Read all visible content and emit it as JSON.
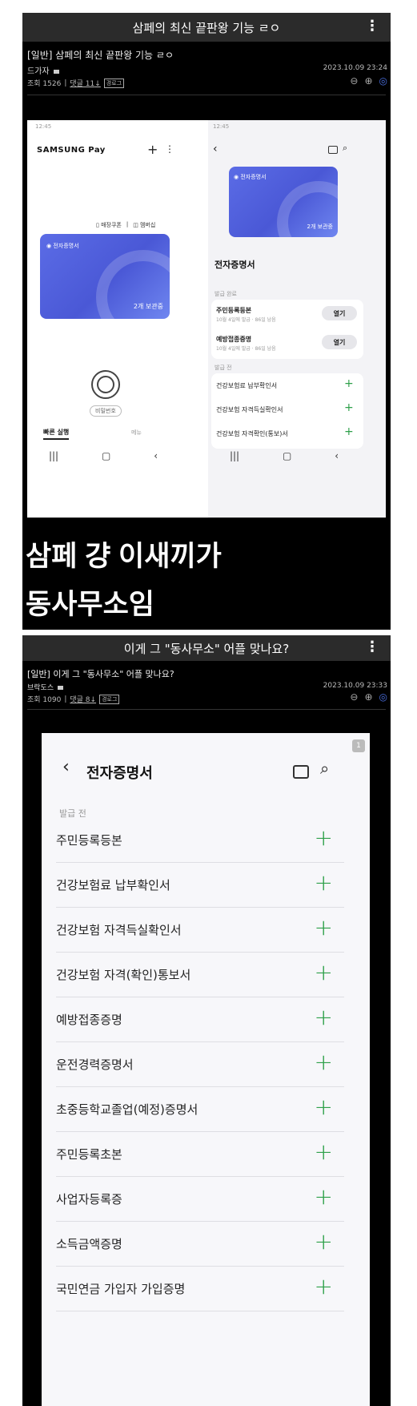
{
  "post1": {
    "header_title": "삼페의 최신 끝판왕 기능 ㄹㅇ",
    "post_title": "[일반] 삼페의 최신 끝판왕 기능 ㄹㅇ",
    "author": "드가자",
    "timestamp": "2023.10.09 23:24",
    "stats_views": "조회 1526",
    "stats_comments": "댓글 11",
    "stats_tag": "경로그",
    "left_phone": {
      "clock": "12:45",
      "brand": "SAMSUNG Pay",
      "plus": "+",
      "coupon": "매장쿠폰",
      "membership": "멤버십",
      "card_label": "전자증명서",
      "card_count": "2개 보관중",
      "pin": "비밀번호",
      "quick_tab": "빠른 실행",
      "menu_tab": "메뉴"
    },
    "right_phone": {
      "clock": "12:45",
      "card_label": "전자증명서",
      "card_count": "2개 보관중",
      "section_title": "전자증명서",
      "issued_label": "발급 완료",
      "issued": [
        {
          "name": "주민등록등본",
          "sub": "10월 4일에 발급 · 86일 남음",
          "button": "열기"
        },
        {
          "name": "예방접종증명",
          "sub": "10월 4일에 발급 · 86일 남음",
          "button": "열기"
        }
      ],
      "pending_label": "발급 전",
      "pending": [
        "건강보험료 납부확인서",
        "건강보험 자격득실확인서",
        "건강보험 자격확인(통보)서"
      ]
    },
    "caption_line1": "삼페 걍 이새끼가",
    "caption_line2": "동사무소임"
  },
  "post2": {
    "header_title": "이게 그 \"동사무소\" 어플 맞나요?",
    "post_title": "[일반] 이게 그 \"동사무소\" 어플 맞나요?",
    "author": "브락도스",
    "timestamp": "2023.10.09 23:33",
    "stats_views": "조회 1090",
    "stats_comments": "댓글 8",
    "stats_tag": "경로그",
    "badge": "1",
    "screen_title": "전자증명서",
    "section_label": "발급 전",
    "items": [
      "주민등록등본",
      "건강보험료 납부확인서",
      "건강보험 자격득실확인서",
      "건강보험 자격(확인)통보서",
      "예방접종증명",
      "운전경력증명서",
      "초중등학교졸업(예정)증명서",
      "주민등록초본",
      "사업자등록증",
      "소득금액증명",
      "국민연금 가입자 가입증명"
    ]
  },
  "colors": {
    "accent_green": "#2ea04a",
    "card_blue": "#5060e0",
    "bar_dark": "#2b2b2b"
  }
}
